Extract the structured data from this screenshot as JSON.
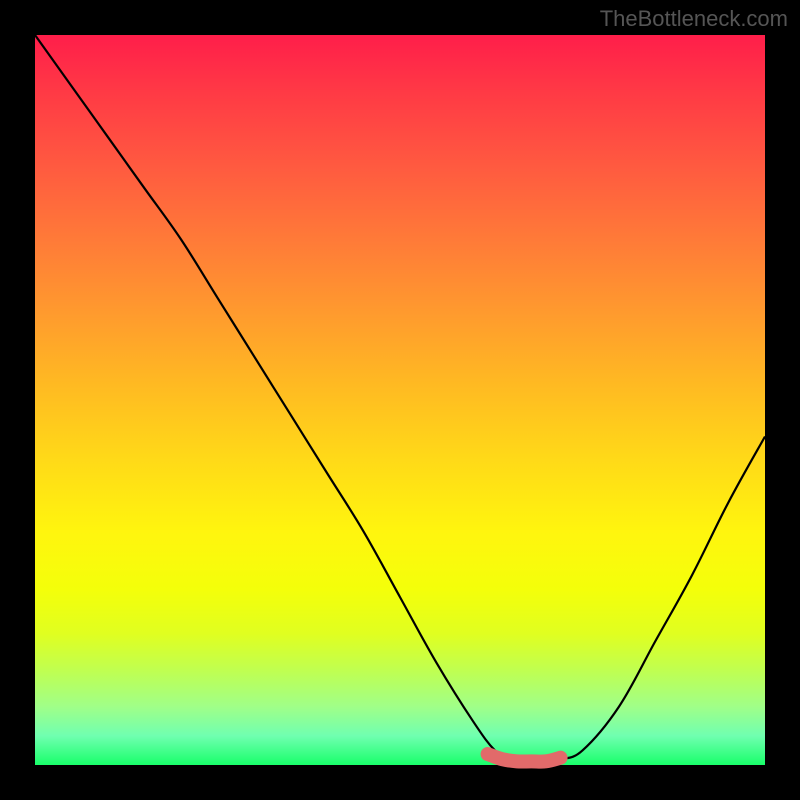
{
  "watermark": "TheBottleneck.com",
  "chart_data": {
    "type": "line",
    "title": "",
    "xlabel": "",
    "ylabel": "",
    "xlim": [
      0,
      100
    ],
    "ylim": [
      0,
      100
    ],
    "series": [
      {
        "name": "bottleneck-curve",
        "x": [
          0,
          5,
          10,
          15,
          20,
          25,
          30,
          35,
          40,
          45,
          50,
          55,
          60,
          63,
          65,
          68,
          70,
          72,
          75,
          80,
          85,
          90,
          95,
          100
        ],
        "values": [
          100,
          93,
          86,
          79,
          72,
          64,
          56,
          48,
          40,
          32,
          23,
          14,
          6,
          2,
          1,
          0.5,
          0.5,
          0.8,
          2,
          8,
          17,
          26,
          36,
          45
        ]
      },
      {
        "name": "optimal-zone-marker",
        "x": [
          62,
          64,
          66,
          68,
          70,
          72
        ],
        "values": [
          1.5,
          0.8,
          0.5,
          0.5,
          0.5,
          1.0
        ]
      }
    ],
    "colors": {
      "curve": "#000000",
      "marker": "#e26a6a",
      "gradient_top": "#ff1e4a",
      "gradient_bottom": "#18ff6a"
    }
  }
}
